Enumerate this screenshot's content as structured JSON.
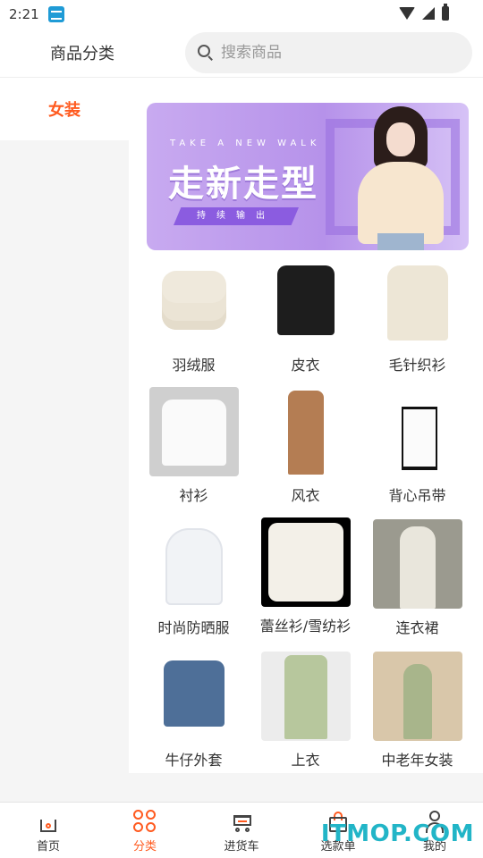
{
  "status_bar": {
    "time": "2:21"
  },
  "header": {
    "title": "商品分类",
    "search": {
      "placeholder": "搜索商品"
    }
  },
  "sidebar": {
    "items": [
      {
        "label": "女装",
        "active": true
      }
    ]
  },
  "banner": {
    "subtitle": "TAKE A NEW WALK",
    "headline": "走新走型",
    "ribbon": "持续输出"
  },
  "categories": [
    {
      "label": "羽绒服",
      "icon": "down-jacket"
    },
    {
      "label": "皮衣",
      "icon": "leather-jacket"
    },
    {
      "label": "毛针织衫",
      "icon": "knit-sweater"
    },
    {
      "label": "衬衫",
      "icon": "shirt"
    },
    {
      "label": "风衣",
      "icon": "trench-coat"
    },
    {
      "label": "背心吊带",
      "icon": "camisole"
    },
    {
      "label": "时尚防晒服",
      "icon": "sun-protection-jacket"
    },
    {
      "label": "蕾丝衫/雪纺衫",
      "icon": "lace-blouse"
    },
    {
      "label": "连衣裙",
      "icon": "dress"
    },
    {
      "label": "牛仔外套",
      "icon": "denim-jacket"
    },
    {
      "label": "上衣",
      "icon": "top"
    },
    {
      "label": "中老年女装",
      "icon": "elderly-womenswear"
    }
  ],
  "bottom_nav": [
    {
      "label": "首页",
      "icon": "home-icon"
    },
    {
      "label": "分类",
      "icon": "grid-icon",
      "active": true
    },
    {
      "label": "进货车",
      "icon": "cart-icon"
    },
    {
      "label": "选款单",
      "icon": "bag-icon"
    },
    {
      "label": "我的",
      "icon": "user-icon"
    }
  ],
  "watermark": "ITMOP.COM",
  "colors": {
    "accent": "#ff5a1f",
    "watermark": "#22b5c7"
  }
}
